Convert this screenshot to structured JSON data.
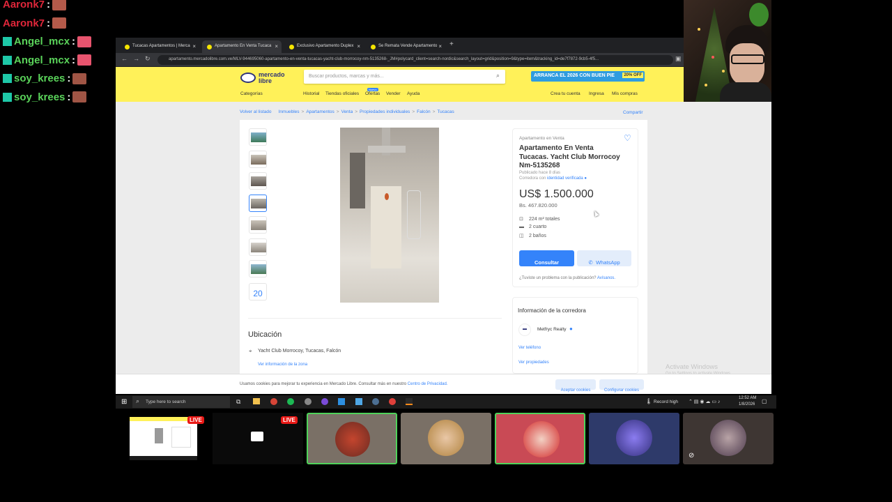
{
  "chat": [
    {
      "user": "Aaronk7",
      "sep": ":",
      "color": "#e0263a"
    },
    {
      "user": "Aaronk7",
      "sep": ":",
      "color": "#e0263a"
    },
    {
      "user": "Angel_mcx",
      "sep": ":",
      "color": "#5ad35a"
    },
    {
      "user": "Angel_mcx",
      "sep": ":",
      "color": "#5ad35a"
    },
    {
      "user": "soy_krees",
      "sep": ":",
      "color": "#5ad35a"
    },
    {
      "user": "soy_krees",
      "sep": ":",
      "color": "#5ad35a"
    }
  ],
  "browser": {
    "tabs": [
      {
        "title": "Tucacas Apartamentos | Merca"
      },
      {
        "title": "Apartamento En Venta Tucaca"
      },
      {
        "title": "Exclusivo Apartamento Duplex"
      },
      {
        "title": "Se Remata Vende Apartamento"
      }
    ],
    "new_tab": "+",
    "url": "apartamento.mercadolibre.com.ve/MLV-944695060-apartamento-en-venta-tucacas-yacht-club-morrocoy-nm-5135268-_JM#polycard_client=search-nordic&search_layout=grid&position=9&type=item&tracking_id=de7f7872-9cb5-4f5..."
  },
  "ml": {
    "logo_line1": "mercado",
    "logo_line2": "libre",
    "search_placeholder": "Buscar productos, marcas y más...",
    "promo": "ARRANCA EL 2026 CON BUEN PIE",
    "promo_badge": "20% OFF",
    "nav": {
      "categorias": "Categorías",
      "historial": "Historial",
      "tiendas": "Tiendas oficiales",
      "ofertas": "Ofertas",
      "ofertas_badge": "Nuevo",
      "vender": "Vender",
      "ayuda": "Ayuda",
      "crea": "Crea tu cuenta",
      "ingresa": "Ingresa",
      "compras": "Mis compras"
    },
    "breadcrumb": {
      "back": "Volver al listado",
      "items": [
        "Inmuebles",
        "Apartamentos",
        "Venta",
        "Propiedades individuales",
        "Falcón",
        "Tucacas"
      ],
      "sep": ">",
      "share": "Compartir"
    },
    "thumb_more": "20",
    "listing": {
      "category": "Apartamento en Venta",
      "title": "Apartamento En Venta Tucacas. Yacht Club Morrocoy Nm-5135268",
      "published": "Publicado hace 8 días",
      "seller_prefix": "Corredora con",
      "seller_verified": "identidad verificada",
      "price": "US$ 1.500.000",
      "price_bs": "Bs. 467.820.000",
      "features": [
        {
          "icon": "area-icon",
          "text": "224 m² totales"
        },
        {
          "icon": "bed-icon",
          "text": "2 cuarto"
        },
        {
          "icon": "bath-icon",
          "text": "2 baños"
        }
      ],
      "btn_consult": "Consultar",
      "btn_whatsapp": "WhatsApp",
      "problem": "¿Tuviste un problema con la publicación?",
      "problem_link": "Avísanos."
    },
    "agency": {
      "heading": "Información de la corredora",
      "name": "Metfryc Realty",
      "ver_telefono": "Ver teléfono",
      "ver_propiedades": "Ver propiedades"
    },
    "location": {
      "heading": "Ubicación",
      "address": "Yacht Club Morrocoy, Tucacas, Falcón",
      "zone_link": "Ver información de la zona"
    },
    "cookies": {
      "text": "Usamos cookies para mejorar tu experiencia en Mercado Libre. Consultar más en nuestro",
      "link": "Centro de Privacidad.",
      "accept": "Aceptar cookies",
      "config": "Configurar cookies"
    }
  },
  "watermark": {
    "line1": "Activate Windows",
    "line2": "Go to Settings to activate Windows."
  },
  "taskbar": {
    "search": "Type here to search",
    "record": "Record high",
    "time": "12:52 AM",
    "date": "1/8/2026"
  },
  "cams": {
    "live_label": "LIVE"
  }
}
